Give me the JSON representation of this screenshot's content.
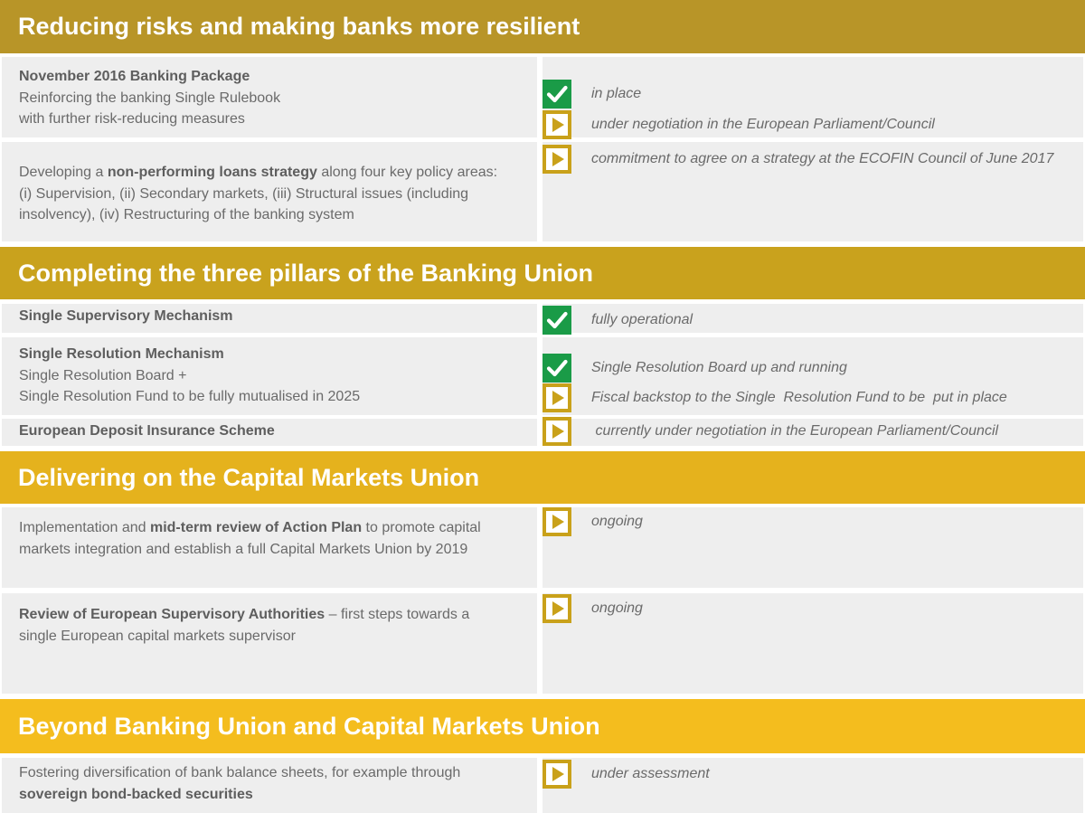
{
  "colors": {
    "band1": "#b89528",
    "band2": "#c9a21d",
    "band3": "#e5b21d",
    "band4": "#f4bd1e",
    "check": "#1a9b47",
    "arrow": "#c9a11a",
    "cell_bg": "#eeeeee"
  },
  "sections": [
    {
      "title": "Reducing risks and making banks more resilient",
      "rows": [
        {
          "lines": [
            [
              {
                "t": "November 2016 Banking Package",
                "b": true
              }
            ],
            [
              {
                "t": "Reinforcing the banking Single Rulebook"
              }
            ],
            [
              {
                "t": "with further risk-reducing measures"
              }
            ]
          ],
          "statuses": [
            {
              "icon": "check-icon",
              "text": "in place"
            },
            {
              "icon": "play-arrow-icon",
              "text": "under negotiation in the European Parliament/Council"
            }
          ]
        },
        {
          "lines": [
            [
              {
                "t": "Developing a "
              },
              {
                "t": "non-performing loans strategy",
                "b": true
              },
              {
                "t": " along four key policy areas:"
              }
            ],
            [
              {
                "t": "(i) Supervision, (ii) Secondary markets, (iii) Structural issues (including"
              }
            ],
            [
              {
                "t": "insolvency), (iv) Restructuring of the banking system"
              }
            ]
          ],
          "statuses": [
            {
              "icon": "play-arrow-icon",
              "text": "commitment to agree on a strategy at the ECOFIN Council of June 2017"
            }
          ]
        }
      ]
    },
    {
      "title": "Completing the three pillars of the Banking Union",
      "rows": [
        {
          "lines": [
            [
              {
                "t": "Single Supervisory Mechanism",
                "b": true
              }
            ]
          ],
          "statuses": [
            {
              "icon": "check-icon",
              "text": "fully operational"
            }
          ]
        },
        {
          "lines": [
            [
              {
                "t": "Single Resolution Mechanism",
                "b": true
              }
            ],
            [
              {
                "t": "Single Resolution Board +"
              }
            ],
            [
              {
                "t": "Single Resolution Fund to be fully mutualised in 2025"
              }
            ]
          ],
          "statuses": [
            {
              "icon": "check-icon",
              "text": "Single Resolution Board up and running"
            },
            {
              "icon": "play-arrow-icon",
              "text": "Fiscal backstop to the Single  Resolution Fund to be  put in place"
            }
          ]
        },
        {
          "lines": [
            [
              {
                "t": "European Deposit Insurance Scheme",
                "b": true
              }
            ]
          ],
          "statuses": [
            {
              "icon": "play-arrow-icon",
              "text": " currently under negotiation in the European Parliament/Council"
            }
          ]
        }
      ]
    },
    {
      "title": "Delivering on the Capital Markets Union",
      "rows": [
        {
          "lines": [
            [
              {
                "t": "Implementation and "
              },
              {
                "t": "mid-term review of Action Plan",
                "b": true
              },
              {
                "t": " to promote capital"
              }
            ],
            [
              {
                "t": "markets integration and establish a full Capital Markets Union by 2019"
              }
            ]
          ],
          "statuses": [
            {
              "icon": "play-arrow-icon",
              "text": "ongoing"
            }
          ]
        },
        {
          "lines": [
            [
              {
                "t": "Review of European Supervisory Authorities",
                "b": true
              },
              {
                "t": " – first steps towards a"
              }
            ],
            [
              {
                "t": "single European capital markets supervisor"
              }
            ]
          ],
          "statuses": [
            {
              "icon": "play-arrow-icon",
              "text": "ongoing"
            }
          ]
        }
      ]
    },
    {
      "title": "Beyond Banking Union and Capital Markets Union",
      "rows": [
        {
          "lines": [
            [
              {
                "t": "Fostering diversification of bank balance sheets, for example through"
              }
            ],
            [
              {
                "t": "sovereign bond-backed securities",
                "b": true
              }
            ]
          ],
          "statuses": [
            {
              "icon": "play-arrow-icon",
              "text": "under assessment"
            }
          ]
        }
      ]
    }
  ]
}
